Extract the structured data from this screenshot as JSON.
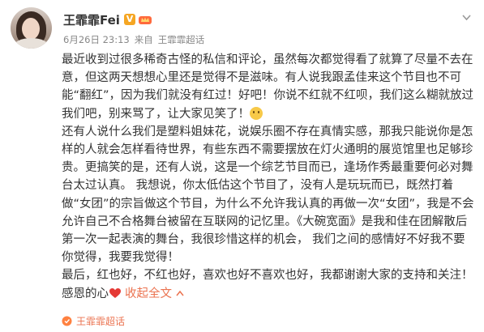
{
  "post": {
    "username": "王霏霏Fei",
    "badge": "V",
    "date": "6月26日 23:13",
    "source_prefix": "来自",
    "source": "王霏霏超话",
    "paragraphs": [
      "最近收到过很多稀奇古怪的私信和评论，虽然每次都觉得看了就算了尽量不去在意，但这两天想想心里还是觉得不是滋味。有人说我跟孟佳来这个节目也不可能“翻红”，因为我们就没有红过！好吧！你说不红就不红呗，我们这么糊就放过我们吧，别来骂了，让大家见笑了！",
      "还有人说什么我们是塑料姐妹花，说娱乐圈不存在真情实感，那我只能说你是怎样的人就会怎样看待世界，有些东西不需要摆放在灯火通明的展览馆里也足够珍贵。更搞笑的是，还有人说，这是一个综艺节目而已，逢场作秀最重要何必对舞台太过认真。  我想说，你太低估这个节目了，没有人是玩玩而已，既然打着做“女团”的宗旨做这个节目，为什么不允许我认真的再做一次“女团”，我是不会允许自己不合格舞台被留在互联网的记忆里。《大碗宽面》是我和佳在团解散后第一次一起表演的舞台，我很珍惜这样的机会，  我们之间的感情好不好我不要你觉得，我要我觉得！",
      "最后，红也好，不红也好，喜欢也好不喜欢也好，我都谢谢大家的支持和关注！"
    ],
    "last_line": "感恩的心",
    "collapse_label": "收起全文",
    "topic_link": "王霏霏超话"
  },
  "colors": {
    "link": "#eb7350",
    "meta": "#888888",
    "text": "#333333",
    "vip_badge": "#f5a623"
  },
  "icons": [
    "avatar",
    "v-badge-icon",
    "crown-icon",
    "chevron-down-icon",
    "smile-emoji-icon",
    "heart-icon",
    "caret-up-icon",
    "topic-icon"
  ]
}
